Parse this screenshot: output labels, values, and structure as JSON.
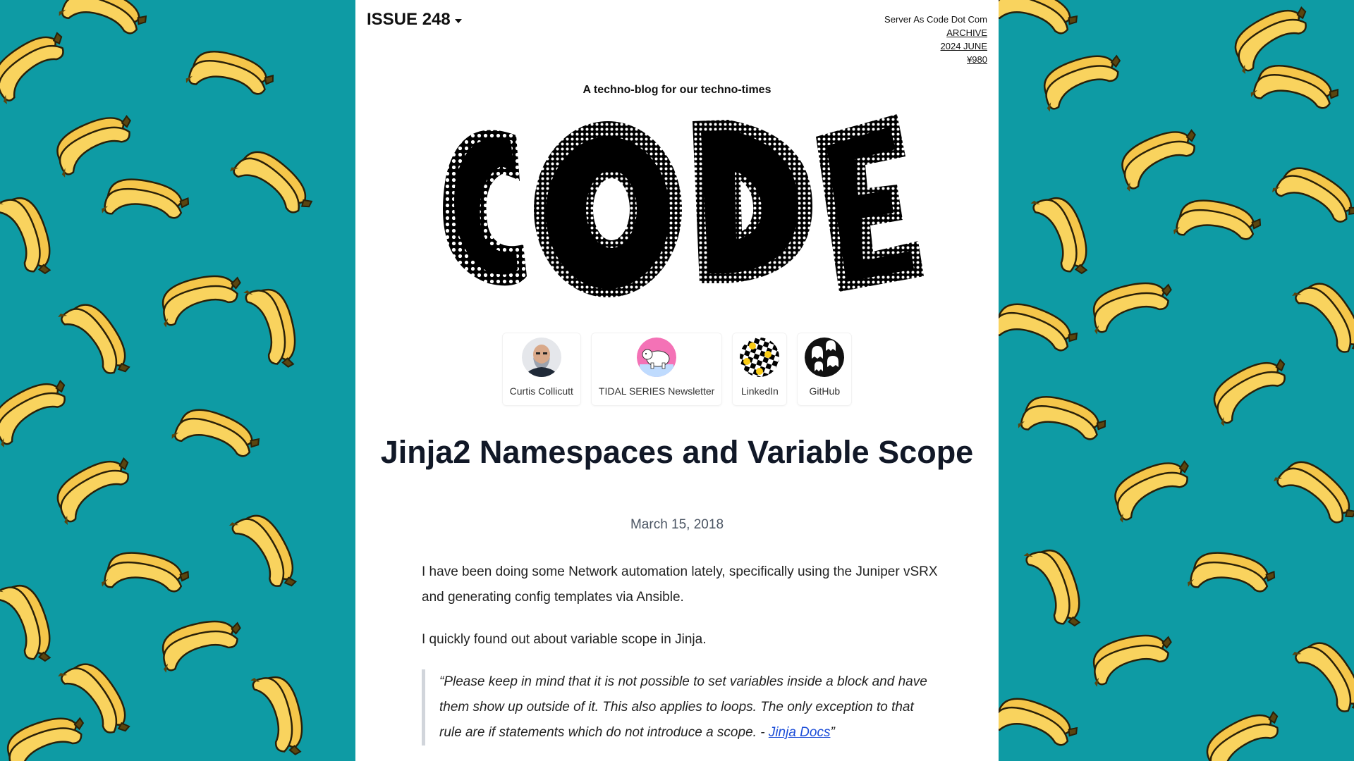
{
  "header": {
    "issue": "ISSUE 248",
    "site_name": "Server As Code Dot Com",
    "archive": "ARCHIVE",
    "edition": "2024 JUNE",
    "price": "¥980",
    "tagline": "A techno-blog for our techno-times",
    "logo_text": "CODE"
  },
  "links": [
    {
      "label": "Curtis Collicutt",
      "icon": "avatar-photo"
    },
    {
      "label": "TIDAL SERIES Newsletter",
      "icon": "bear-icon"
    },
    {
      "label": "LinkedIn",
      "icon": "checker-smiley-icon"
    },
    {
      "label": "GitHub",
      "icon": "ghost-pattern-icon"
    }
  ],
  "article": {
    "title": "Jinja2 Namespaces and Variable Scope",
    "date": "March 15, 2018",
    "p1": "I have been doing some Network automation lately, specifically using the Juniper vSRX and generating config templates via Ansible.",
    "p2": "I quickly found out about variable scope in Jinja.",
    "quote_open": "“",
    "quote_text": "Please keep in mind that it is not possible to set variables inside a block and have them show up outside of it. This also applies to loops. The only exception to that rule are if statements which do not introduce a scope. - ",
    "quote_link": "Jinja Docs",
    "quote_close": "”"
  },
  "colors": {
    "background": "#0e9ba4",
    "banana": "#f5c64a",
    "text": "#111827",
    "link": "#1d4ed8"
  }
}
